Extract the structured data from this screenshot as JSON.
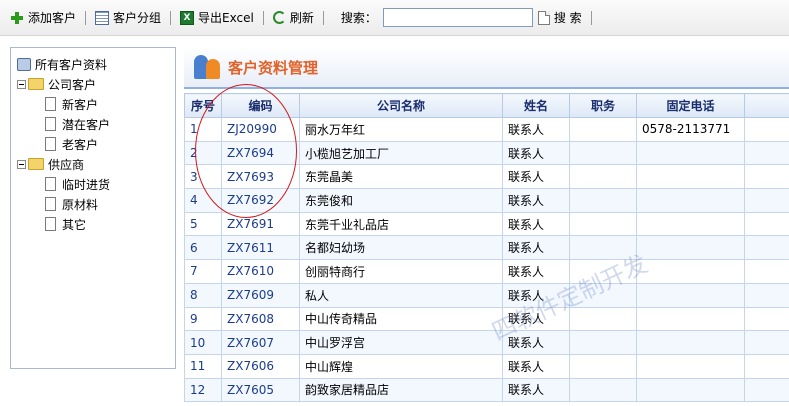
{
  "toolbar": {
    "add_customer": "添加客户",
    "customer_group": "客户分组",
    "export_excel": "导出Excel",
    "refresh": "刷新",
    "search_label": "搜索：",
    "search_value": "",
    "search_button": "搜 索"
  },
  "tree": {
    "root": "所有客户资料",
    "groups": [
      {
        "label": "公司客户",
        "children": [
          "新客户",
          "潜在客户",
          "老客户"
        ]
      },
      {
        "label": "供应商",
        "children": [
          "临时进货",
          "原材料",
          "其它"
        ]
      }
    ]
  },
  "main": {
    "title": "客户资料管理",
    "columns": [
      "序号",
      "编码",
      "公司名称",
      "姓名",
      "职务",
      "固定电话"
    ],
    "rows": [
      {
        "no": "1",
        "code": "ZJ20990",
        "company": "丽水万年红",
        "name": "联系人",
        "title": "",
        "phone": "0578-2113771"
      },
      {
        "no": "2",
        "code": "ZX7694",
        "company": "小榄旭艺加工厂",
        "name": "联系人",
        "title": "",
        "phone": ""
      },
      {
        "no": "3",
        "code": "ZX7693",
        "company": "东莞晶美",
        "name": "联系人",
        "title": "",
        "phone": ""
      },
      {
        "no": "4",
        "code": "ZX7692",
        "company": "东莞俊和",
        "name": "联系人",
        "title": "",
        "phone": ""
      },
      {
        "no": "5",
        "code": "ZX7691",
        "company": "东莞千业礼品店",
        "name": "联系人",
        "title": "",
        "phone": ""
      },
      {
        "no": "6",
        "code": "ZX7611",
        "company": "名都妇幼场",
        "name": "联系人",
        "title": "",
        "phone": ""
      },
      {
        "no": "7",
        "code": "ZX7610",
        "company": "创丽特商行",
        "name": "联系人",
        "title": "",
        "phone": ""
      },
      {
        "no": "8",
        "code": "ZX7609",
        "company": "私人",
        "name": "联系人",
        "title": "",
        "phone": ""
      },
      {
        "no": "9",
        "code": "ZX7608",
        "company": "中山传奇精品",
        "name": "联系人",
        "title": "",
        "phone": ""
      },
      {
        "no": "10",
        "code": "ZX7607",
        "company": "中山罗浮宫",
        "name": "联系人",
        "title": "",
        "phone": ""
      },
      {
        "no": "11",
        "code": "ZX7606",
        "company": "中山辉煌",
        "name": "联系人",
        "title": "",
        "phone": ""
      },
      {
        "no": "12",
        "code": "ZX7605",
        "company": "韵致家居精品店",
        "name": "联系人",
        "title": "",
        "phone": ""
      }
    ]
  },
  "watermark": "四软件定制开发",
  "colors": {
    "title_orange": "#e2622a",
    "header_blue": "#1a2d6e",
    "annotation_red": "#d21b1b"
  }
}
